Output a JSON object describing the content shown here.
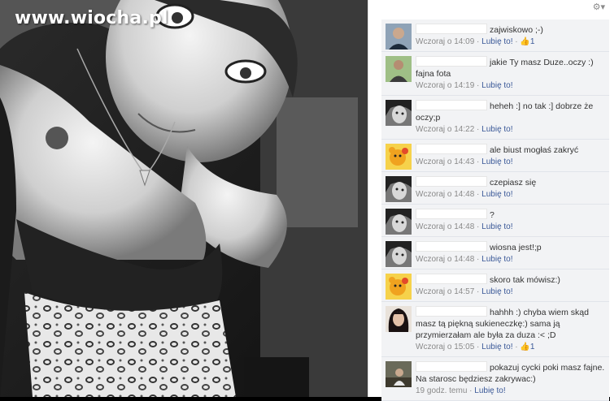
{
  "watermark": "www.wiocha.pl",
  "icons": {
    "settings": "gear-icon",
    "like_count": "thumbs-up-icon"
  },
  "colors": {
    "link": "#3b5998",
    "comment_bg": "#f2f3f5",
    "meta": "#8a8a8a"
  },
  "comments": [
    {
      "text": "zajwiskowo ;-)",
      "time": "Wczoraj o 14:09",
      "like": "Lubię to!",
      "likes": "1",
      "avatar": "man-dark-shirt"
    },
    {
      "text": "jakie Ty masz Duze..oczy :) fajna fota",
      "time": "Wczoraj o 14:19",
      "like": "Lubię to!",
      "likes": "",
      "avatar": "man-green"
    },
    {
      "text": "heheh :] no tak :] dobrze że oczy;p",
      "time": "Wczoraj o 14:22",
      "like": "Lubię to!",
      "likes": "",
      "avatar": "woman-bw"
    },
    {
      "text": "ale biust mogłaś zakryć",
      "time": "Wczoraj o 14:43",
      "like": "Lubię to!",
      "likes": "",
      "avatar": "cartoon-bear"
    },
    {
      "text": "czepiasz się",
      "time": "Wczoraj o 14:48",
      "like": "Lubię to!",
      "likes": "",
      "avatar": "woman-bw"
    },
    {
      "text": "?",
      "time": "Wczoraj o 14:48",
      "like": "Lubię to!",
      "likes": "",
      "avatar": "woman-bw"
    },
    {
      "text": "wiosna jest!;p",
      "time": "Wczoraj o 14:48",
      "like": "Lubię to!",
      "likes": "",
      "avatar": "woman-bw"
    },
    {
      "text": "skoro tak mówisz:)",
      "time": "Wczoraj o 14:57",
      "like": "Lubię to!",
      "likes": "",
      "avatar": "cartoon-bear"
    },
    {
      "text": "hahhh :) chyba wiem skąd masz tą piękną sukieneczkę:) sama ją przymierzałam ale była za duza :< ;D",
      "time": "Wczoraj o 15:05",
      "like": "Lubię to!",
      "likes": "1",
      "avatar": "woman-dark-hair"
    },
    {
      "text": "pokazuj cycki poki masz fajne. Na starosc będziesz zakrywac:)",
      "time": "19 godz. temu",
      "like": "Lubię to!",
      "likes": "",
      "avatar": "man-outdoor"
    }
  ]
}
